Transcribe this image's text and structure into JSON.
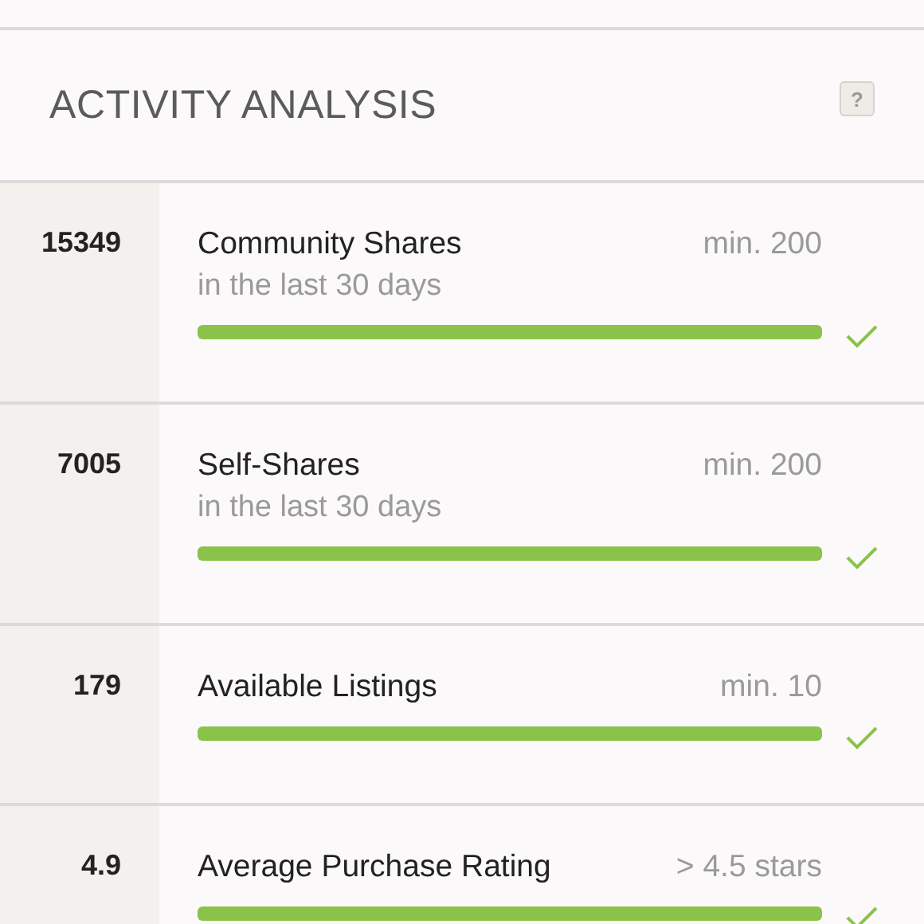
{
  "header": {
    "title": "ACTIVITY ANALYSIS",
    "help_label": "?"
  },
  "metrics": [
    {
      "value": "15349",
      "name": "Community Shares",
      "requirement": "min. 200",
      "period": "in the last 30 days",
      "level": 1,
      "met": true
    },
    {
      "value": "7005",
      "name": "Self-Shares",
      "requirement": "min. 200",
      "period": "in the last 30 days",
      "level": 1,
      "met": true
    },
    {
      "value": "179",
      "name": "Available Listings",
      "requirement": "min. 10",
      "level": 1,
      "met": true
    },
    {
      "value": "4.9",
      "name": "Average Purchase Rating",
      "requirement": "> 4.5 stars",
      "level": 1,
      "met": true
    }
  ]
}
